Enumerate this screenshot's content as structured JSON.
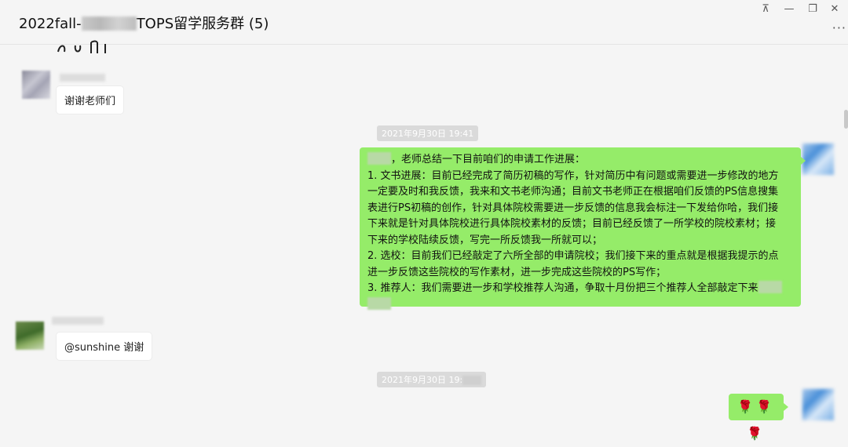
{
  "window": {
    "title_prefix": "2022fall-",
    "title_suffix": "TOPS留学服务群 (5)",
    "controls": {
      "pin": "⊼",
      "minimize": "—",
      "restore": "❐",
      "close": "✕",
      "more": "···"
    }
  },
  "messages": [
    {
      "sender": "left",
      "text": "谢谢老师们"
    },
    {
      "timestamp": "2021年9月30日 19:41"
    },
    {
      "sender": "right",
      "greeting": "，老师总结一下目前咱们的申请工作进展：",
      "lines": [
        "1. 文书进展：目前已经完成了简历初稿的写作，针对简历中有问题或需要进一步修改的地方",
        "一定要及时和我反馈，我来和文书老师沟通；目前文书老师正在根据咱们反馈的PS信息搜集",
        "表进行PS初稿的创作，针对具体院校需要进一步反馈的信息我会标注一下发给你哈，我们接",
        "下来就是针对具体院校进行具体院校素材的反馈；目前已经反馈了一所学校的院校素材；接",
        "下来的学校陆续反馈，写完一所反馈我一所就可以；",
        "2. 选校：目前我们已经敲定了六所全部的申请院校；我们接下来的重点就是根据我提示的点",
        "进一步反馈这些院校的写作素材，进一步完成这些院校的PS写作；",
        "3. 推荐人：我们需要进一步和学校推荐人沟通，争取十月份把三个推荐人全部敲定下来"
      ]
    },
    {
      "sender": "left",
      "text": "@sunshine 谢谢"
    },
    {
      "timestamp": "2021年9月30日 19:"
    },
    {
      "sender": "right",
      "emoji": "🌹🌹🌹"
    }
  ]
}
